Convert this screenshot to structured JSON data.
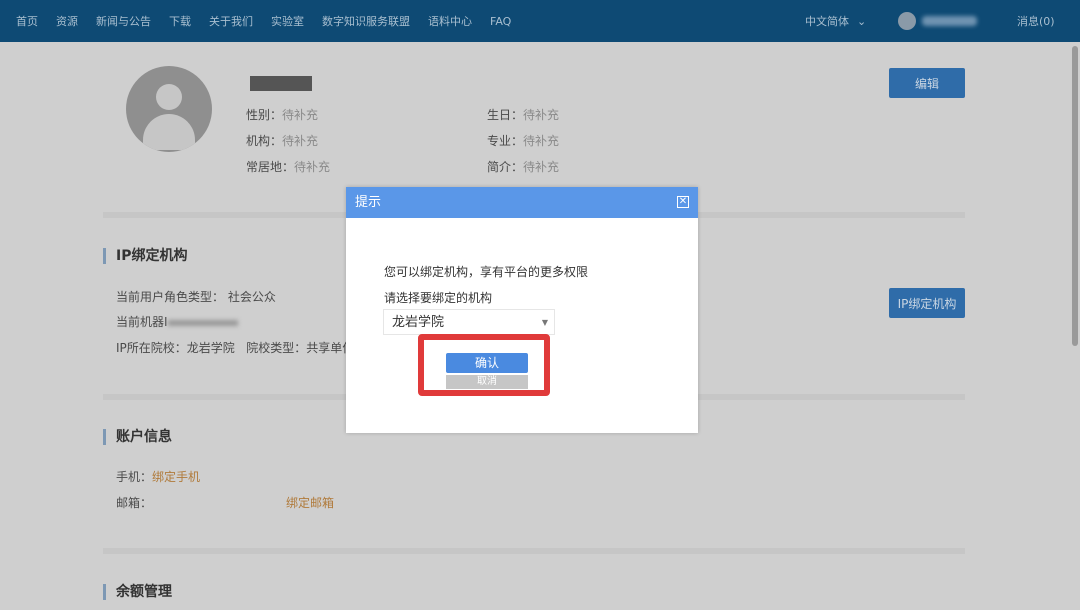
{
  "nav": {
    "items": [
      "首页",
      "资源",
      "新闻与公告",
      "下载",
      "关于我们",
      "实验室",
      "数字知识服务联盟",
      "语料中心",
      "FAQ"
    ],
    "language": "中文简体",
    "messages": "消息(0)"
  },
  "profile": {
    "gender_label": "性别：",
    "gender": "待补充",
    "birthday_label": "生日：",
    "birthday": "待补充",
    "org_label": "机构：",
    "org": "待补充",
    "major_label": "专业：",
    "major": "待补充",
    "residence_label": "常居地：",
    "residence": "待补充",
    "intro_label": "简介：",
    "intro": "待补充",
    "edit_button": "编辑"
  },
  "ip_section": {
    "title": "IP绑定机构",
    "role_label": "当前用户角色类型：",
    "role": "社会公众",
    "machine_label": "当前机器I",
    "school_label": "IP所在院校：",
    "school": "龙岩学院",
    "school_type_label": "院校类型：",
    "school_type": "共享单位",
    "bind_button": "IP绑定机构"
  },
  "account": {
    "title": "账户信息",
    "phone_label": "手机：",
    "phone_link": "绑定手机",
    "email_label": "邮箱：",
    "email_link": "绑定邮箱"
  },
  "balance": {
    "title": "余额管理"
  },
  "dialog": {
    "title": "提示",
    "message": "您可以绑定机构，享有平台的更多权限",
    "select_label": "请选择要绑定的机构",
    "selected": "龙岩学院",
    "confirm": "确认",
    "cancel": "取消"
  },
  "colors": {
    "header": "#0e4a74",
    "dialog_title": "#5a97e8",
    "highlight": "#e03a3a",
    "link": "#b07a3a"
  }
}
